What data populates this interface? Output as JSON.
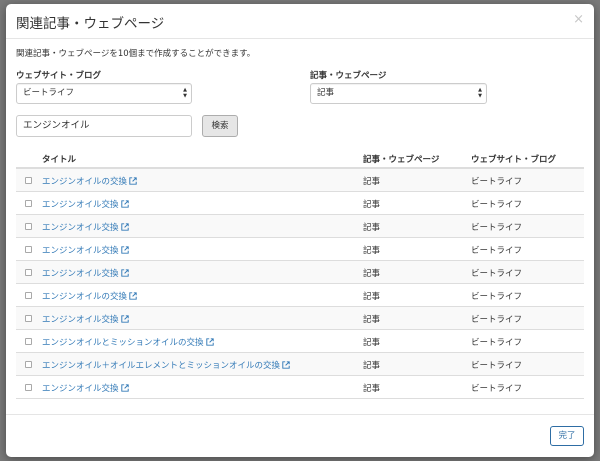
{
  "modal": {
    "title": "関連記事・ウェブページ",
    "close_glyph": "×",
    "description": "関連記事・ウェブページを10個まで作成することができます。"
  },
  "filters": {
    "website_label": "ウェブサイト・ブログ",
    "website_value": "ビートライフ",
    "type_label": "記事・ウェブページ",
    "type_value": "記事"
  },
  "search": {
    "value": "エンジンオイル",
    "button_label": "検索"
  },
  "table": {
    "headers": {
      "title": "タイトル",
      "type": "記事・ウェブページ",
      "site": "ウェブサイト・ブログ"
    },
    "rows": [
      {
        "title": "エンジンオイルの交換",
        "type": "記事",
        "site": "ビートライフ"
      },
      {
        "title": "エンジンオイル交換",
        "type": "記事",
        "site": "ビートライフ"
      },
      {
        "title": "エンジンオイル交換",
        "type": "記事",
        "site": "ビートライフ"
      },
      {
        "title": "エンジンオイル交換",
        "type": "記事",
        "site": "ビートライフ"
      },
      {
        "title": "エンジンオイル交換",
        "type": "記事",
        "site": "ビートライフ"
      },
      {
        "title": "エンジンオイルの交換",
        "type": "記事",
        "site": "ビートライフ"
      },
      {
        "title": "エンジンオイル交換",
        "type": "記事",
        "site": "ビートライフ"
      },
      {
        "title": "エンジンオイルとミッションオイルの交換",
        "type": "記事",
        "site": "ビートライフ"
      },
      {
        "title": "エンジンオイル＋オイルエレメントとミッションオイルの交換",
        "type": "記事",
        "site": "ビートライフ"
      },
      {
        "title": "エンジンオイル交換",
        "type": "記事",
        "site": "ビートライフ"
      }
    ]
  },
  "footer": {
    "done_label": "完了"
  },
  "colors": {
    "link": "#337ab7",
    "primary_border": "#2e6da4"
  }
}
